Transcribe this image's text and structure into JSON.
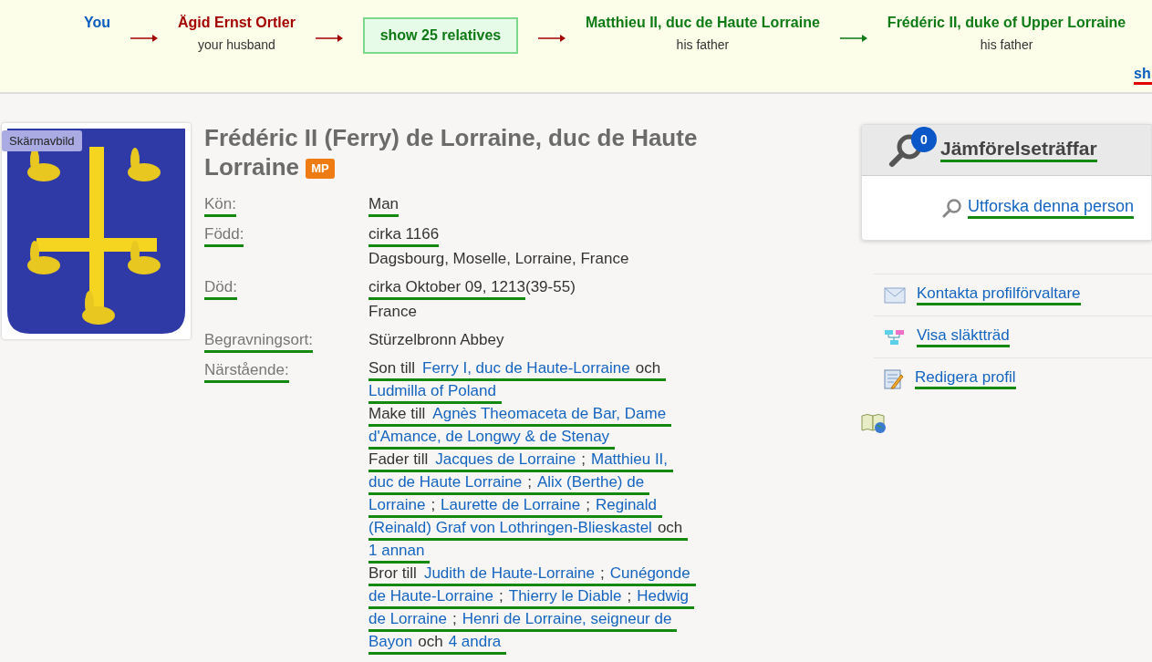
{
  "path_bar": {
    "chain": [
      {
        "kind": "person",
        "name": "You",
        "color": "#0a5cbf"
      },
      {
        "kind": "arrow",
        "color": "#a30000"
      },
      {
        "kind": "person",
        "name": "Ägid Ernst Ortler",
        "relation": "your husband",
        "color": "#a30000"
      },
      {
        "kind": "arrow",
        "color": "#a30000"
      },
      {
        "kind": "button",
        "label": "show 25 relatives"
      },
      {
        "kind": "arrow",
        "color": "#a30000"
      },
      {
        "kind": "person",
        "name": "Matthieu II, duc de Haute Lorraine",
        "relation": "his father",
        "color": "#0d7a14"
      },
      {
        "kind": "arrow",
        "color": "#0d7a14"
      },
      {
        "kind": "person",
        "name": "Frédéric II, duke of Upper Lorraine",
        "relation": "his father",
        "color": "#0d7a14"
      }
    ],
    "more_link": "sh"
  },
  "photo": {
    "tag": "Skärmavbild"
  },
  "profile": {
    "title": "Frédéric II (Ferry) de Lorraine, duc de Haute Lorraine",
    "badge": "MP",
    "facts": [
      {
        "label": "Kön:",
        "lines": [
          [
            {
              "kind": "text",
              "text": "Man",
              "mark": true
            }
          ]
        ]
      },
      {
        "label": "Född:",
        "lines": [
          [
            {
              "kind": "text",
              "text": "cirka 1166",
              "mark": true
            }
          ],
          [
            {
              "kind": "text",
              "text": "Dagsbourg, Moselle, Lorraine, France",
              "mark": false
            }
          ]
        ]
      },
      {
        "label": "Död:",
        "lines": [
          [
            {
              "kind": "text",
              "text": "cirka Oktober 09, 1213",
              "mark": true
            },
            {
              "kind": "text",
              "text": " (39-55)",
              "mark": false
            }
          ],
          [
            {
              "kind": "text",
              "text": "France",
              "mark": false
            }
          ]
        ]
      },
      {
        "label": "Begravningsort:",
        "lines": [
          [
            {
              "kind": "text",
              "text": "Stürzelbronn Abbey",
              "mark": false
            }
          ]
        ]
      }
    ],
    "relatives_label": "Närstående:",
    "relative_lines": [
      [
        {
          "kind": "text",
          "text": "Son till"
        },
        {
          "kind": "link",
          "text": "Ferry I, duc de Haute-Lorraine"
        },
        {
          "kind": "text",
          "text": "och"
        }
      ],
      [
        {
          "kind": "link",
          "text": "Ludmilla of Poland"
        }
      ],
      [
        {
          "kind": "text",
          "text": "Make till"
        },
        {
          "kind": "link",
          "text": "Agnès Theomaceta de Bar, Dame"
        }
      ],
      [
        {
          "kind": "link",
          "text": "d'Amance, de Longwy & de Stenay"
        }
      ],
      [
        {
          "kind": "text",
          "text": "Fader till"
        },
        {
          "kind": "link",
          "text": "Jacques de Lorraine"
        },
        {
          "kind": "text",
          "text": ";"
        },
        {
          "kind": "link",
          "text": "Matthieu II,"
        }
      ],
      [
        {
          "kind": "link",
          "text": "duc de Haute Lorraine"
        },
        {
          "kind": "text",
          "text": ";"
        },
        {
          "kind": "link",
          "text": "Alix (Berthe) de"
        }
      ],
      [
        {
          "kind": "link",
          "text": "Lorraine"
        },
        {
          "kind": "text",
          "text": ";"
        },
        {
          "kind": "link",
          "text": "Laurette de Lorraine"
        },
        {
          "kind": "text",
          "text": ";"
        },
        {
          "kind": "link",
          "text": "Reginald"
        }
      ],
      [
        {
          "kind": "link",
          "text": "(Reinald) Graf von Lothringen-Blieskastel"
        },
        {
          "kind": "text",
          "text": "och"
        }
      ],
      [
        {
          "kind": "link",
          "text": "1 annan"
        }
      ],
      [
        {
          "kind": "text",
          "text": "Bror till"
        },
        {
          "kind": "link",
          "text": "Judith de Haute-Lorraine"
        },
        {
          "kind": "text",
          "text": ";"
        },
        {
          "kind": "link",
          "text": "Cunégonde"
        }
      ],
      [
        {
          "kind": "link",
          "text": "de Haute-Lorraine"
        },
        {
          "kind": "text",
          "text": ";"
        },
        {
          "kind": "link",
          "text": "Thierry le Diable"
        },
        {
          "kind": "text",
          "text": ";"
        },
        {
          "kind": "link",
          "text": "Hedwig"
        }
      ],
      [
        {
          "kind": "link",
          "text": "de Lorraine"
        },
        {
          "kind": "text",
          "text": ";"
        },
        {
          "kind": "link",
          "text": "Henri de Lorraine, seigneur de"
        }
      ],
      [
        {
          "kind": "link",
          "text": "Bayon"
        },
        {
          "kind": "text",
          "text": "och"
        },
        {
          "kind": "link",
          "text": "4 andra"
        }
      ]
    ]
  },
  "sidebar": {
    "matches": {
      "count": "0",
      "title": "Jämförelseträffar",
      "link": "Utforska denna person"
    },
    "actions": [
      {
        "kind": "mail",
        "label": "Kontakta profilförvaltare"
      },
      {
        "kind": "tree",
        "label": "Visa släktträd"
      },
      {
        "kind": "edit",
        "label": "Redigera profil"
      }
    ]
  }
}
